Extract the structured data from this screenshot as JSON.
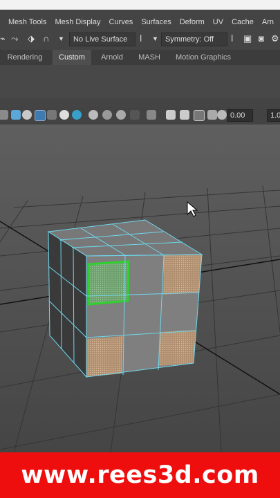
{
  "menu": [
    "Mesh Tools",
    "Mesh Display",
    "Curves",
    "Surfaces",
    "Deform",
    "UV",
    "Cache",
    "Arn"
  ],
  "status": {
    "live_surface": "No Live Surface",
    "symmetry": "Symmetry: Off"
  },
  "shelf_tabs": [
    {
      "label": "Rendering",
      "active": false
    },
    {
      "label": "Custom",
      "active": true
    },
    {
      "label": "Arnold",
      "active": false
    },
    {
      "label": "MASH",
      "active": false
    },
    {
      "label": "Motion Graphics",
      "active": false
    }
  ],
  "viewport_toolbar": {
    "value1": "0.00",
    "value2": "1.0"
  },
  "banner": {
    "text": "www.rees3d.com",
    "color": "#ee0e0e"
  },
  "colors": {
    "selection": "#2fd12f",
    "wireframe": "#6fd8ee",
    "face_tan": "#c9a887"
  }
}
